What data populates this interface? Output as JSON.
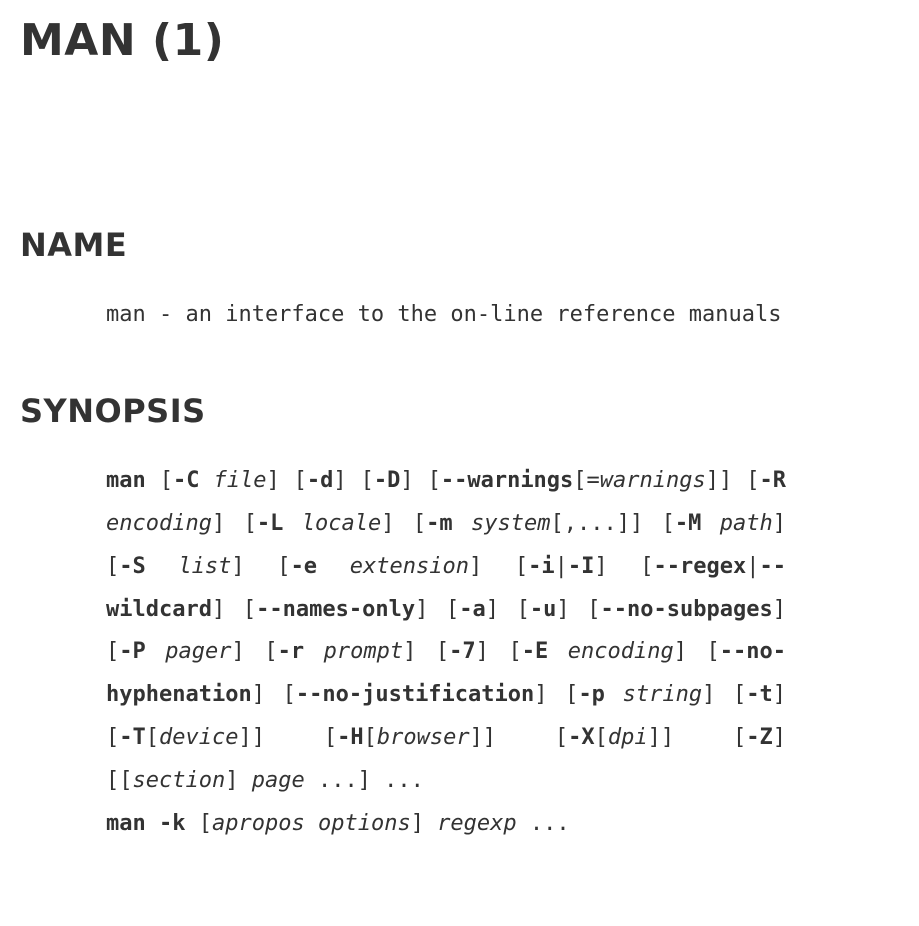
{
  "title": "MAN (1)",
  "sections": {
    "name": {
      "heading": "NAME",
      "text": "man -   an interface to the on-line reference manuals"
    },
    "synopsis": {
      "heading": "SYNOPSIS",
      "tokens": [
        {
          "t": "man",
          "s": "b"
        },
        {
          "t": " [",
          "s": "r"
        },
        {
          "t": "-C",
          "s": "b"
        },
        {
          "t": " ",
          "s": "r"
        },
        {
          "t": "file",
          "s": "i"
        },
        {
          "t": "] [",
          "s": "r"
        },
        {
          "t": "-d",
          "s": "b"
        },
        {
          "t": "] [",
          "s": "r"
        },
        {
          "t": "-D",
          "s": "b"
        },
        {
          "t": "] [",
          "s": "r"
        },
        {
          "t": "--warnings",
          "s": "b"
        },
        {
          "t": "[=",
          "s": "r"
        },
        {
          "t": "warn­ings",
          "s": "i"
        },
        {
          "t": "]] [",
          "s": "r"
        },
        {
          "t": "-R",
          "s": "b"
        },
        {
          "t": " ",
          "s": "r"
        },
        {
          "t": "encoding",
          "s": "i"
        },
        {
          "t": "] [",
          "s": "r"
        },
        {
          "t": "-L",
          "s": "b"
        },
        {
          "t": " ",
          "s": "r"
        },
        {
          "t": "locale",
          "s": "i"
        },
        {
          "t": "] [",
          "s": "r"
        },
        {
          "t": "-m",
          "s": "b"
        },
        {
          "t": " ",
          "s": "r"
        },
        {
          "t": "sys­tem",
          "s": "i"
        },
        {
          "t": "[,...]] [",
          "s": "r"
        },
        {
          "t": "-M",
          "s": "b"
        },
        {
          "t": " ",
          "s": "r"
        },
        {
          "t": "path",
          "s": "i"
        },
        {
          "t": "] [",
          "s": "r"
        },
        {
          "t": "-S",
          "s": "b"
        },
        {
          "t": " ",
          "s": "r"
        },
        {
          "t": "list",
          "s": "i"
        },
        {
          "t": "] [",
          "s": "r"
        },
        {
          "t": "-e",
          "s": "b"
        },
        {
          "t": " ",
          "s": "r"
        },
        {
          "t": "extension",
          "s": "i"
        },
        {
          "t": "] [",
          "s": "r"
        },
        {
          "t": "-i",
          "s": "b"
        },
        {
          "t": "|",
          "s": "r"
        },
        {
          "t": "-I",
          "s": "b"
        },
        {
          "t": "] [",
          "s": "r"
        },
        {
          "t": "--regex",
          "s": "b"
        },
        {
          "t": "|",
          "s": "r"
        },
        {
          "t": "--wildcard",
          "s": "b"
        },
        {
          "t": "] [",
          "s": "r"
        },
        {
          "t": "--names-only",
          "s": "b"
        },
        {
          "t": "] [",
          "s": "r"
        },
        {
          "t": "-a",
          "s": "b"
        },
        {
          "t": "] [",
          "s": "r"
        },
        {
          "t": "-u",
          "s": "b"
        },
        {
          "t": "] [",
          "s": "r"
        },
        {
          "t": "--no-subpages",
          "s": "b"
        },
        {
          "t": "] [",
          "s": "r"
        },
        {
          "t": "-P",
          "s": "b"
        },
        {
          "t": " ",
          "s": "r"
        },
        {
          "t": "pager",
          "s": "i"
        },
        {
          "t": "] [",
          "s": "r"
        },
        {
          "t": "-r",
          "s": "b"
        },
        {
          "t": " ",
          "s": "r"
        },
        {
          "t": "prompt",
          "s": "i"
        },
        {
          "t": "] [",
          "s": "r"
        },
        {
          "t": "-7",
          "s": "b"
        },
        {
          "t": "] [",
          "s": "r"
        },
        {
          "t": "-E",
          "s": "b"
        },
        {
          "t": " ",
          "s": "r"
        },
        {
          "t": "encoding",
          "s": "i"
        },
        {
          "t": "] [",
          "s": "r"
        },
        {
          "t": "--no-hyphenation",
          "s": "b"
        },
        {
          "t": "] [",
          "s": "r"
        },
        {
          "t": "--no-justification",
          "s": "b"
        },
        {
          "t": "] [",
          "s": "r"
        },
        {
          "t": "-p",
          "s": "b"
        },
        {
          "t": " ",
          "s": "r"
        },
        {
          "t": "string",
          "s": "i"
        },
        {
          "t": "] [",
          "s": "r"
        },
        {
          "t": "-t",
          "s": "b"
        },
        {
          "t": "] [",
          "s": "r"
        },
        {
          "t": "-T",
          "s": "b"
        },
        {
          "t": "[",
          "s": "r"
        },
        {
          "t": "device",
          "s": "i"
        },
        {
          "t": "]] [",
          "s": "r"
        },
        {
          "t": "-H",
          "s": "b"
        },
        {
          "t": "[",
          "s": "r"
        },
        {
          "t": "browser",
          "s": "i"
        },
        {
          "t": "]] [",
          "s": "r"
        },
        {
          "t": "-X",
          "s": "b"
        },
        {
          "t": "[",
          "s": "r"
        },
        {
          "t": "dpi",
          "s": "i"
        },
        {
          "t": "]] [",
          "s": "r"
        },
        {
          "t": "-Z",
          "s": "b"
        },
        {
          "t": "] [[",
          "s": "r"
        },
        {
          "t": "section",
          "s": "i"
        },
        {
          "t": "] ",
          "s": "r"
        },
        {
          "t": "page",
          "s": "i"
        },
        {
          "t": " ...] ...",
          "s": "r"
        }
      ],
      "line2": [
        {
          "t": "man",
          "s": "b"
        },
        {
          "t": " ",
          "s": "r"
        },
        {
          "t": "-k",
          "s": "b"
        },
        {
          "t": " [",
          "s": "r"
        },
        {
          "t": "apropos",
          "s": "i"
        },
        {
          "t": " ",
          "s": "r"
        },
        {
          "t": "options",
          "s": "i"
        },
        {
          "t": "] ",
          "s": "r"
        },
        {
          "t": "regexp",
          "s": "i"
        },
        {
          "t": " ...",
          "s": "r"
        }
      ]
    }
  }
}
